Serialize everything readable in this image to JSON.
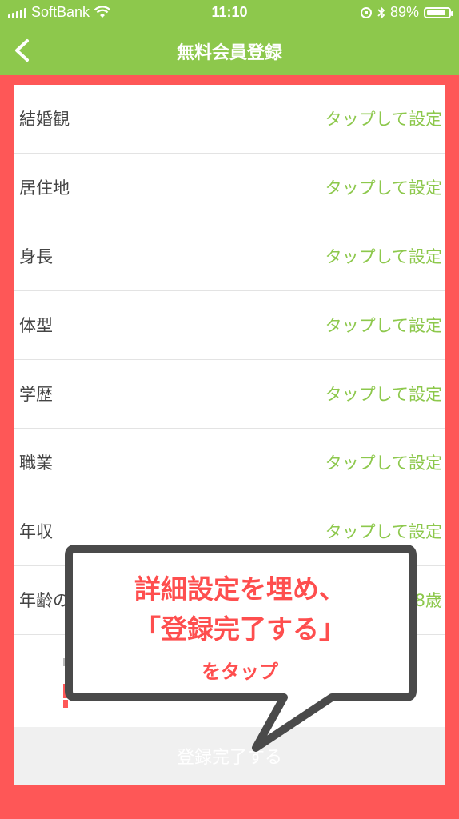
{
  "status_bar": {
    "carrier": "SoftBank",
    "time": "11:10",
    "battery": "89%",
    "battery_level": 0.89
  },
  "nav": {
    "title": "無料会員登録"
  },
  "rows": [
    {
      "label": "結婚観",
      "value": "タップして設定"
    },
    {
      "label": "居住地",
      "value": "タップして設定"
    },
    {
      "label": "身長",
      "value": "タップして設定"
    },
    {
      "label": "体型",
      "value": "タップして設定"
    },
    {
      "label": "学歴",
      "value": "タップして設定"
    },
    {
      "label": "職業",
      "value": "タップして設定"
    },
    {
      "label": "年収",
      "value": "タップして設定"
    },
    {
      "label": "年齢の",
      "value": "8歳"
    }
  ],
  "submit": {
    "label": "登録完了する"
  },
  "callout": {
    "line1": "詳細設定を埋め、",
    "line2": "「登録完了する」",
    "line3": "をタップ"
  },
  "colors": {
    "brand_green": "#8dc84c",
    "highlight_red": "#fe5757"
  }
}
